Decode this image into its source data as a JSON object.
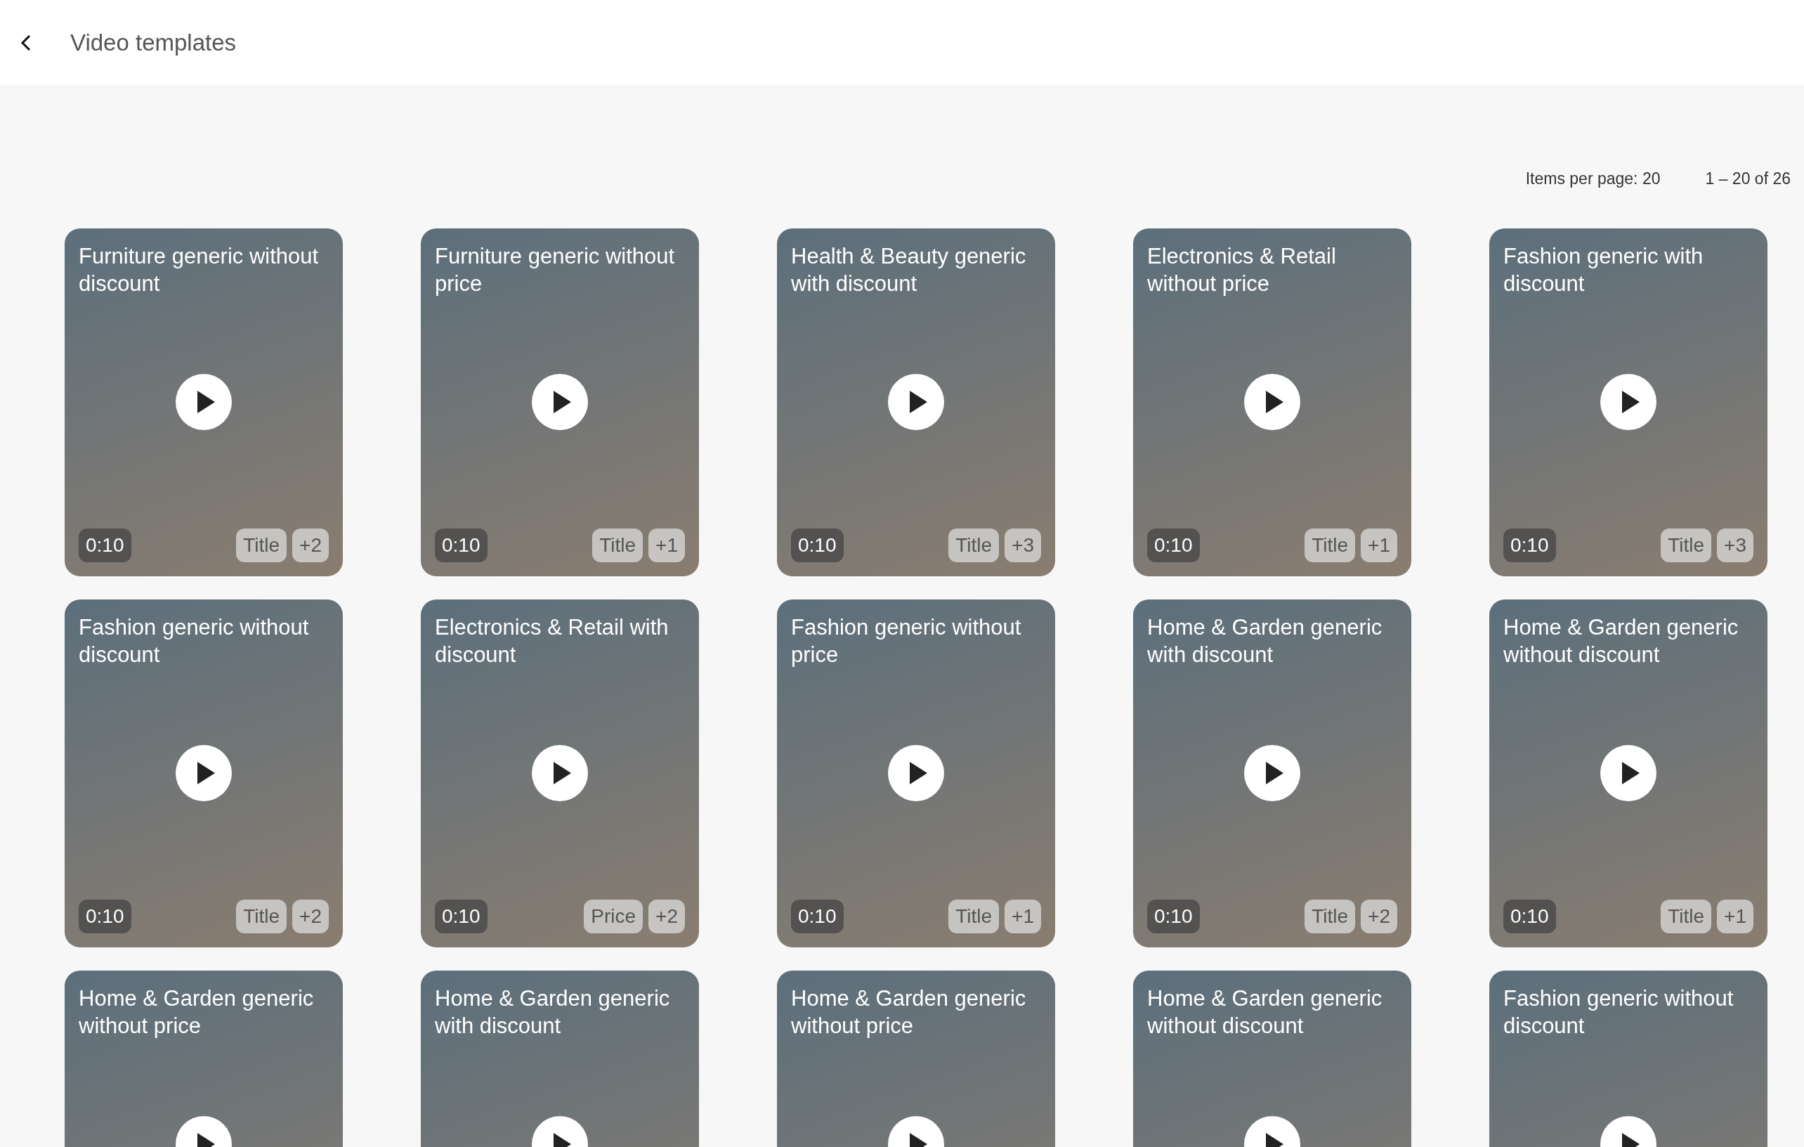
{
  "header": {
    "title": "Video templates"
  },
  "pagination": {
    "items_per_page": "Items per page: 20",
    "range": "1 – 20 of 26"
  },
  "templates": [
    {
      "title": "Furniture generic without discount",
      "duration": "0:10",
      "tags": [
        "Title",
        "+2"
      ]
    },
    {
      "title": "Furniture generic without price",
      "duration": "0:10",
      "tags": [
        "Title",
        "+1"
      ]
    },
    {
      "title": "Health & Beauty generic with discount",
      "duration": "0:10",
      "tags": [
        "Title",
        "+3"
      ]
    },
    {
      "title": "Electronics & Retail without price",
      "duration": "0:10",
      "tags": [
        "Title",
        "+1"
      ]
    },
    {
      "title": "Fashion generic with discount",
      "duration": "0:10",
      "tags": [
        "Title",
        "+3"
      ]
    },
    {
      "title": "Fashion generic without discount",
      "duration": "0:10",
      "tags": [
        "Title",
        "+2"
      ]
    },
    {
      "title": "Electronics & Retail with discount",
      "duration": "0:10",
      "tags": [
        "Price",
        "+2"
      ]
    },
    {
      "title": "Fashion generic without price",
      "duration": "0:10",
      "tags": [
        "Title",
        "+1"
      ]
    },
    {
      "title": "Home & Garden generic with discount",
      "duration": "0:10",
      "tags": [
        "Title",
        "+2"
      ]
    },
    {
      "title": "Home & Garden generic without discount",
      "duration": "0:10",
      "tags": [
        "Title",
        "+1"
      ]
    },
    {
      "title": "Home & Garden generic without price"
    },
    {
      "title": "Home & Garden generic with discount"
    },
    {
      "title": "Home & Garden generic without price"
    },
    {
      "title": "Home & Garden generic without discount"
    },
    {
      "title": "Fashion generic without discount"
    }
  ]
}
